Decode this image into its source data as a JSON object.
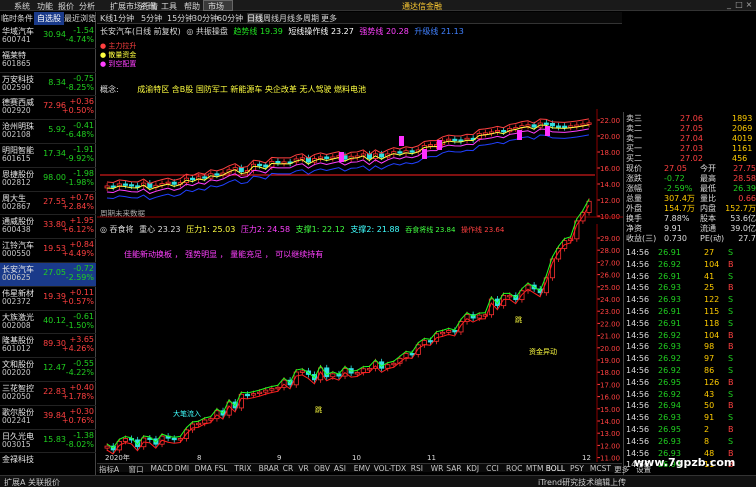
{
  "menubar": {
    "items": [
      "系统",
      "功能",
      "报价",
      "分析",
      "扩展市场行情",
      "资讯",
      "工具",
      "帮助",
      "市场"
    ],
    "login_text": "通达信金融"
  },
  "left": {
    "headers": [
      "临时条件",
      "自选股",
      "最近浏览"
    ],
    "stocks": [
      {
        "name": "华域汽车",
        "code": "600741",
        "price": "30.94",
        "chg": "-1.54",
        "pct": "-4.74%",
        "dir": "dn"
      },
      {
        "name": "福莱特",
        "code": "601865",
        "price": "",
        "chg": "",
        "pct": "",
        "dir": "dn"
      },
      {
        "name": "万安科技",
        "code": "002590",
        "price": "8.34",
        "chg": "-0.75",
        "pct": "-8.25%",
        "dir": "dn"
      },
      {
        "name": "德赛西威",
        "code": "002920",
        "price": "72.96",
        "chg": "+0.36",
        "pct": "+0.50%",
        "dir": "up"
      },
      {
        "name": "沧州明珠",
        "code": "002108",
        "price": "5.92",
        "chg": "-0.41",
        "pct": "-6.48%",
        "dir": "dn"
      },
      {
        "name": "明阳智能",
        "code": "601615",
        "price": "17.34",
        "chg": "-1.91",
        "pct": "-9.92%",
        "dir": "dn"
      },
      {
        "name": "恩捷股份",
        "code": "002812",
        "price": "98.00",
        "chg": "-1.98",
        "pct": "-1.98%",
        "dir": "dn"
      },
      {
        "name": "周大生",
        "code": "002867",
        "price": "27.55",
        "chg": "+0.76",
        "pct": "+2.84%",
        "dir": "up"
      },
      {
        "name": "通威股份",
        "code": "600438",
        "price": "33.80",
        "chg": "+1.95",
        "pct": "+6.12%",
        "dir": "up"
      },
      {
        "name": "江铃汽车",
        "code": "000550",
        "price": "19.53",
        "chg": "+0.84",
        "pct": "+4.49%",
        "dir": "up"
      },
      {
        "name": "长安汽车",
        "code": "000625",
        "price": "27.05",
        "chg": "-0.72",
        "pct": "-2.59%",
        "dir": "dn",
        "sel": true
      },
      {
        "name": "伟星新材",
        "code": "002372",
        "price": "19.39",
        "chg": "+0.11",
        "pct": "+0.57%",
        "dir": "up"
      },
      {
        "name": "大族激光",
        "code": "002008",
        "price": "40.12",
        "chg": "-0.61",
        "pct": "-1.50%",
        "dir": "dn"
      },
      {
        "name": "隆基股份",
        "code": "601012",
        "price": "89.30",
        "chg": "+3.65",
        "pct": "+4.26%",
        "dir": "up"
      },
      {
        "name": "文和股份",
        "code": "002020",
        "price": "12.47",
        "chg": "-0.55",
        "pct": "-4.22%",
        "dir": "dn"
      },
      {
        "name": "三花智控",
        "code": "002050",
        "price": "22.83",
        "chg": "+0.40",
        "pct": "+1.78%",
        "dir": "up"
      },
      {
        "name": "歌尔股份",
        "code": "002241",
        "price": "39.84",
        "chg": "+0.30",
        "pct": "+0.76%",
        "dir": "up"
      },
      {
        "name": "日久光电",
        "code": "003015",
        "price": "15.83",
        "chg": "-1.38",
        "pct": "-8.02%",
        "dir": "dn"
      },
      {
        "name": "金禄科技",
        "code": "",
        "price": "",
        "chg": "",
        "pct": "",
        "dir": "dn"
      }
    ]
  },
  "toolbar": {
    "items": [
      "1分钟",
      "5分钟",
      "15分钟",
      "30分钟",
      "60分钟",
      "周线",
      "月线",
      "多周期",
      "更多"
    ],
    "prefix": "K线"
  },
  "upper_chart": {
    "title_name": "长安汽车(日线 前复权)",
    "title_ind": "◎ 共振操盘",
    "t1": "趋势线 19.39",
    "t2": "短线操作线 23.27",
    "t3": "强势线 20.28",
    "t4": "升级线 21.13",
    "legend": [
      "主力拉升",
      "散量资金",
      "到空配置"
    ],
    "concept": "概念:",
    "concept_text": "成渝特区 含B股 国防军工 新能源车 央企改革 无人驾驶 燃料电池",
    "chart_label": "周期未来数据",
    "price_ticks": [
      "22.00",
      "20.00",
      "18.00",
      "16.00",
      "14.00",
      "12.00",
      "10.00"
    ]
  },
  "lower_chart": {
    "title": "◎ 吞食将",
    "t1": "重心 23.23",
    "t2": "压力1: 25.03",
    "t3": "压力2: 24.58",
    "t4": "支撑1: 22.12",
    "t5": "支撑2: 21.88",
    "t6": "吞食将线 23.84",
    "t7": "操作线 23.64",
    "note1": "佳能新动换板",
    "note2": "强势明显",
    "note3": "量能充足",
    "note4": "可以继续持有",
    "date_axis": [
      "2020年",
      "8",
      "9",
      "10",
      "11",
      "12"
    ],
    "labels": [
      "大笔流入",
      "跳",
      "跳",
      "资金异动"
    ],
    "price_ticks": [
      "29.00",
      "28.00",
      "27.00",
      "26.00",
      "25.00",
      "24.00",
      "23.00",
      "22.00",
      "21.00",
      "20.00",
      "19.00",
      "18.00",
      "17.00",
      "16.00",
      "15.00",
      "14.00",
      "13.00",
      "12.00",
      "11.00"
    ]
  },
  "orderbook": [
    {
      "label": "卖三",
      "price": "27.06",
      "vol": "1893"
    },
    {
      "label": "卖二",
      "price": "27.05",
      "vol": "2069"
    },
    {
      "label": "卖一",
      "price": "27.04",
      "vol": "4019"
    },
    {
      "label": "买一",
      "price": "27.03",
      "vol": "1161"
    },
    {
      "label": "买二",
      "price": "27.02",
      "vol": "456"
    }
  ],
  "quote": [
    {
      "l": "现价",
      "v": "27.05",
      "l2": "今开",
      "v2": "27.75"
    },
    {
      "l": "涨跌",
      "v": "-0.72",
      "l2": "最高",
      "v2": "28.58"
    },
    {
      "l": "涨幅",
      "v": "-2.59%",
      "l2": "最低",
      "v2": "26.39"
    },
    {
      "l": "总量",
      "v": "307.4万",
      "l2": "量比",
      "v2": "0.66"
    },
    {
      "l": "外盘",
      "v": "154.7万",
      "l2": "内盘",
      "v2": "152.7万"
    },
    {
      "l": "换手",
      "v": "7.88%",
      "l2": "股本",
      "v2": "53.6亿"
    },
    {
      "l": "净资",
      "v": "9.91",
      "l2": "流通",
      "v2": "39.0亿"
    },
    {
      "l": "收益(三)",
      "v": "0.730",
      "l2": "PE(动)",
      "v2": "27.7"
    }
  ],
  "ticks": [
    {
      "t": "14:56",
      "p": "26.91",
      "v": "27",
      "s": "S"
    },
    {
      "t": "14:56",
      "p": "26.92",
      "v": "104",
      "s": "B"
    },
    {
      "t": "14:56",
      "p": "26.91",
      "v": "41",
      "s": "S"
    },
    {
      "t": "14:56",
      "p": "26.93",
      "v": "25",
      "s": "B"
    },
    {
      "t": "14:56",
      "p": "26.93",
      "v": "122",
      "s": "S"
    },
    {
      "t": "14:56",
      "p": "26.91",
      "v": "115",
      "s": "S"
    },
    {
      "t": "14:56",
      "p": "26.91",
      "v": "118",
      "s": "S"
    },
    {
      "t": "14:56",
      "p": "26.92",
      "v": "104",
      "s": "B"
    },
    {
      "t": "14:56",
      "p": "26.93",
      "v": "98",
      "s": "B"
    },
    {
      "t": "14:56",
      "p": "26.92",
      "v": "97",
      "s": "S"
    },
    {
      "t": "14:56",
      "p": "26.92",
      "v": "86",
      "s": "S"
    },
    {
      "t": "14:56",
      "p": "26.95",
      "v": "126",
      "s": "B"
    },
    {
      "t": "14:56",
      "p": "26.92",
      "v": "43",
      "s": "S"
    },
    {
      "t": "14:56",
      "p": "26.94",
      "v": "50",
      "s": "B"
    },
    {
      "t": "14:56",
      "p": "26.93",
      "v": "91",
      "s": "S"
    },
    {
      "t": "14:56",
      "p": "26.95",
      "v": "2",
      "s": "B"
    },
    {
      "t": "14:56",
      "p": "26.93",
      "v": "8",
      "s": "S"
    },
    {
      "t": "14:56",
      "p": "26.93",
      "v": "48",
      "s": "B"
    },
    {
      "t": "14:56",
      "p": "26.94",
      "v": "11",
      "s": "B"
    }
  ],
  "indicator_tabs": [
    "指标A",
    "窗口",
    "MACD",
    "DMI",
    "DMA",
    "FSL",
    "TRIX",
    "BRAR",
    "CR",
    "VR",
    "OBV",
    "ASI",
    "EMV",
    "VOL-TDX",
    "RSI",
    "WR",
    "SAR",
    "KDJ",
    "CCI",
    "ROC",
    "MTM",
    "BOLL",
    "PSY",
    "MCST",
    "更多",
    "设置"
  ],
  "status": {
    "left": "扩展A 关联报价",
    "right": "iTrend研究技术编辑上传"
  },
  "watermark": "www.7gpzb.com"
}
